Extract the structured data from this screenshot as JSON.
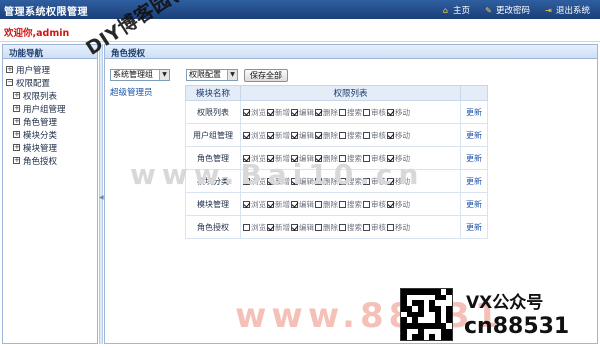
{
  "header": {
    "title": "管理系统权限管理",
    "links": [
      {
        "label": "主页",
        "icon": "home-icon"
      },
      {
        "label": "更改密码",
        "icon": "key-icon"
      },
      {
        "label": "退出系统",
        "icon": "exit-icon"
      }
    ]
  },
  "welcome": "欢迎你,admin",
  "sidebar": {
    "title": "功能导航",
    "items": [
      {
        "label": "用户管理",
        "level": 0
      },
      {
        "label": "权限配置",
        "level": 0
      },
      {
        "label": "权限列表",
        "level": 1
      },
      {
        "label": "用户组管理",
        "level": 1
      },
      {
        "label": "角色管理",
        "level": 1
      },
      {
        "label": "模块分类",
        "level": 1
      },
      {
        "label": "模块管理",
        "level": 1
      },
      {
        "label": "角色授权",
        "level": 1
      }
    ]
  },
  "main": {
    "title": "角色授权",
    "select1": "系统管理组",
    "select2": "权限配置",
    "save_all": "保存全部",
    "role_link": "超级管理员",
    "table": {
      "col_module": "模块名称",
      "col_perms": "权限列表",
      "rows": [
        {
          "name": "权限列表",
          "action": "更新",
          "perms": [
            {
              "l": "浏览",
              "c": true
            },
            {
              "l": "新增",
              "c": true
            },
            {
              "l": "编辑",
              "c": true
            },
            {
              "l": "删除",
              "c": true
            },
            {
              "l": "搜索",
              "c": false
            },
            {
              "l": "审核",
              "c": false
            },
            {
              "l": "移动",
              "c": true
            }
          ]
        },
        {
          "name": "用户组管理",
          "action": "更新",
          "perms": [
            {
              "l": "浏览",
              "c": true
            },
            {
              "l": "新增",
              "c": true
            },
            {
              "l": "编辑",
              "c": true
            },
            {
              "l": "删除",
              "c": true
            },
            {
              "l": "搜索",
              "c": false
            },
            {
              "l": "审核",
              "c": false
            },
            {
              "l": "移动",
              "c": true
            }
          ]
        },
        {
          "name": "角色管理",
          "action": "更新",
          "perms": [
            {
              "l": "浏览",
              "c": true
            },
            {
              "l": "新增",
              "c": true
            },
            {
              "l": "编辑",
              "c": true
            },
            {
              "l": "删除",
              "c": true
            },
            {
              "l": "搜索",
              "c": false
            },
            {
              "l": "审核",
              "c": false
            },
            {
              "l": "移动",
              "c": true
            }
          ]
        },
        {
          "name": "模块分类",
          "action": "更新",
          "perms": [
            {
              "l": "浏览",
              "c": true
            },
            {
              "l": "新增",
              "c": true
            },
            {
              "l": "编辑",
              "c": true
            },
            {
              "l": "删除",
              "c": true
            },
            {
              "l": "搜索",
              "c": false
            },
            {
              "l": "审核",
              "c": false
            },
            {
              "l": "移动",
              "c": true
            }
          ]
        },
        {
          "name": "模块管理",
          "action": "更新",
          "perms": [
            {
              "l": "浏览",
              "c": true
            },
            {
              "l": "新增",
              "c": true
            },
            {
              "l": "编辑",
              "c": true
            },
            {
              "l": "删除",
              "c": false
            },
            {
              "l": "搜索",
              "c": false
            },
            {
              "l": "审核",
              "c": false
            },
            {
              "l": "移动",
              "c": true
            }
          ]
        },
        {
          "name": "角色授权",
          "action": "更新",
          "perms": [
            {
              "l": "浏览",
              "c": false
            },
            {
              "l": "新增",
              "c": true
            },
            {
              "l": "编辑",
              "c": true
            },
            {
              "l": "删除",
              "c": false
            },
            {
              "l": "搜索",
              "c": false
            },
            {
              "l": "审核",
              "c": false
            },
            {
              "l": "移动",
              "c": false
            }
          ]
        }
      ]
    }
  },
  "watermarks": {
    "url": "DIY博客园(diybloghome.com)",
    "gray": "www.Bai10.cn",
    "red": "www.88531",
    "wechat1": "VX公众号",
    "wechat2": "cn88531"
  }
}
